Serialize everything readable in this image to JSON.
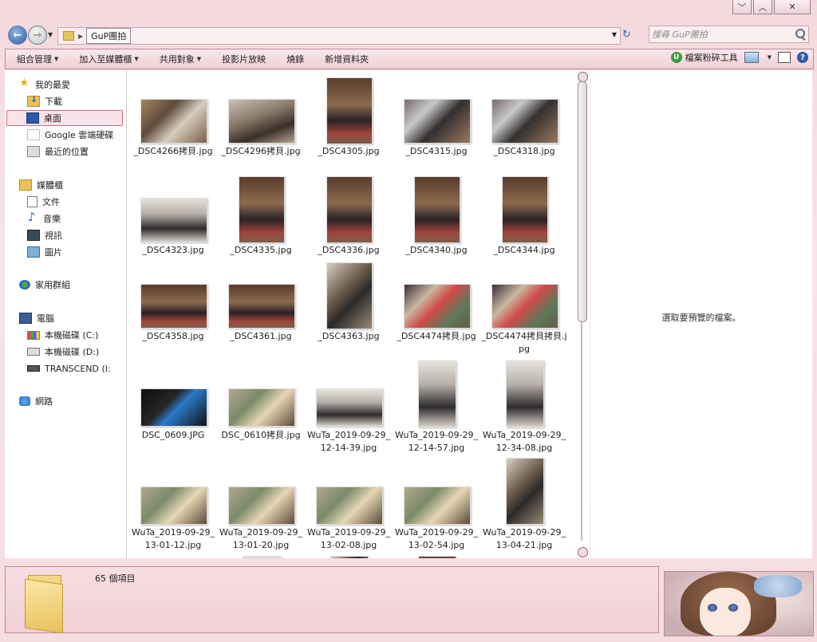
{
  "window": {
    "buttons": {
      "minimize": "﹀",
      "maximize": "︿",
      "close": "✕"
    }
  },
  "address": {
    "crumb": "GuP團拍",
    "search_placeholder": "搜尋 GuP團拍"
  },
  "toolbar": {
    "items": [
      "組合管理",
      "加入至媒體櫃",
      "共用對象",
      "投影片放映",
      "燒錄",
      "新增資料夾"
    ],
    "shredder": "檔案粉碎工具"
  },
  "nav": {
    "favorites": "我的最愛",
    "downloads": "下載",
    "desktop": "桌面",
    "google_drive": "Google 雲端硬碟",
    "recent": "最近的位置",
    "libraries": "媒體櫃",
    "documents": "文件",
    "music": "音樂",
    "videos": "視訊",
    "pictures": "圖片",
    "homegroup": "家用群組",
    "computer": "電腦",
    "drive_c": "本機磁碟 (C:)",
    "drive_d": "本機磁碟 (D:)",
    "transcend": "TRANSCEND (I:",
    "network": "網路"
  },
  "files": [
    {
      "name": "_DSC4266拷貝.jpg"
    },
    {
      "name": "_DSC4296拷貝.jpg"
    },
    {
      "name": "_DSC4305.jpg"
    },
    {
      "name": "_DSC4315.jpg"
    },
    {
      "name": "_DSC4318.jpg"
    },
    {
      "name": "_DSC4323.jpg"
    },
    {
      "name": "_DSC4335.jpg"
    },
    {
      "name": "_DSC4336.jpg"
    },
    {
      "name": "_DSC4340.jpg"
    },
    {
      "name": "_DSC4344.jpg"
    },
    {
      "name": "_DSC4358.jpg"
    },
    {
      "name": "_DSC4361.jpg"
    },
    {
      "name": "_DSC4363.jpg"
    },
    {
      "name": "_DSC4474拷貝.jpg"
    },
    {
      "name": "_DSC4474拷貝拷貝.jpg"
    },
    {
      "name": "DSC_0609.JPG"
    },
    {
      "name": "DSC_0610拷貝.jpg"
    },
    {
      "name": "WuTa_2019-09-29_12-14-39.jpg"
    },
    {
      "name": "WuTa_2019-09-29_12-14-57.jpg"
    },
    {
      "name": "WuTa_2019-09-29_12-34-08.jpg"
    },
    {
      "name": "WuTa_2019-09-29_13-01-12.jpg"
    },
    {
      "name": "WuTa_2019-09-29_13-01-20.jpg"
    },
    {
      "name": "WuTa_2019-09-29_13-02-08.jpg"
    },
    {
      "name": "WuTa_2019-09-29_13-02-54.jpg"
    },
    {
      "name": "WuTa_2019-09-29_13-04-21.jpg"
    }
  ],
  "preview": {
    "message": "選取要預覽的檔案。"
  },
  "details": {
    "count": "65 個項目"
  }
}
